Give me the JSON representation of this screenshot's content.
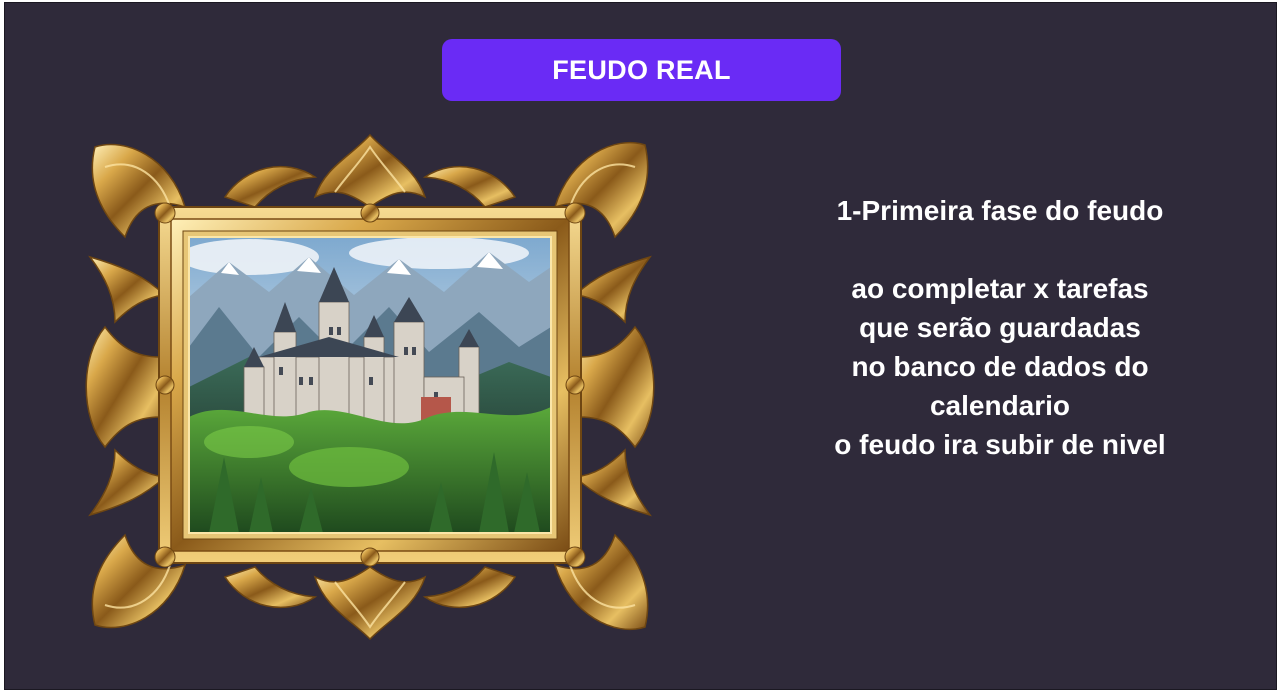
{
  "header": {
    "title": "FEUDO REAL"
  },
  "picture": {
    "subject": "castle-in-mountains",
    "frame_style": "ornate-gold"
  },
  "info": {
    "phase": "1-Primeira fase do feudo",
    "lines": [
      "ao completar x tarefas",
      "que serão guardadas",
      "no banco de dados do",
      "calendario",
      "o feudo ira subir de nivel"
    ]
  },
  "colors": {
    "background": "#2f2a3a",
    "accent": "#6a2bf5",
    "text": "#ffffff",
    "gold": "#c99a3a"
  }
}
